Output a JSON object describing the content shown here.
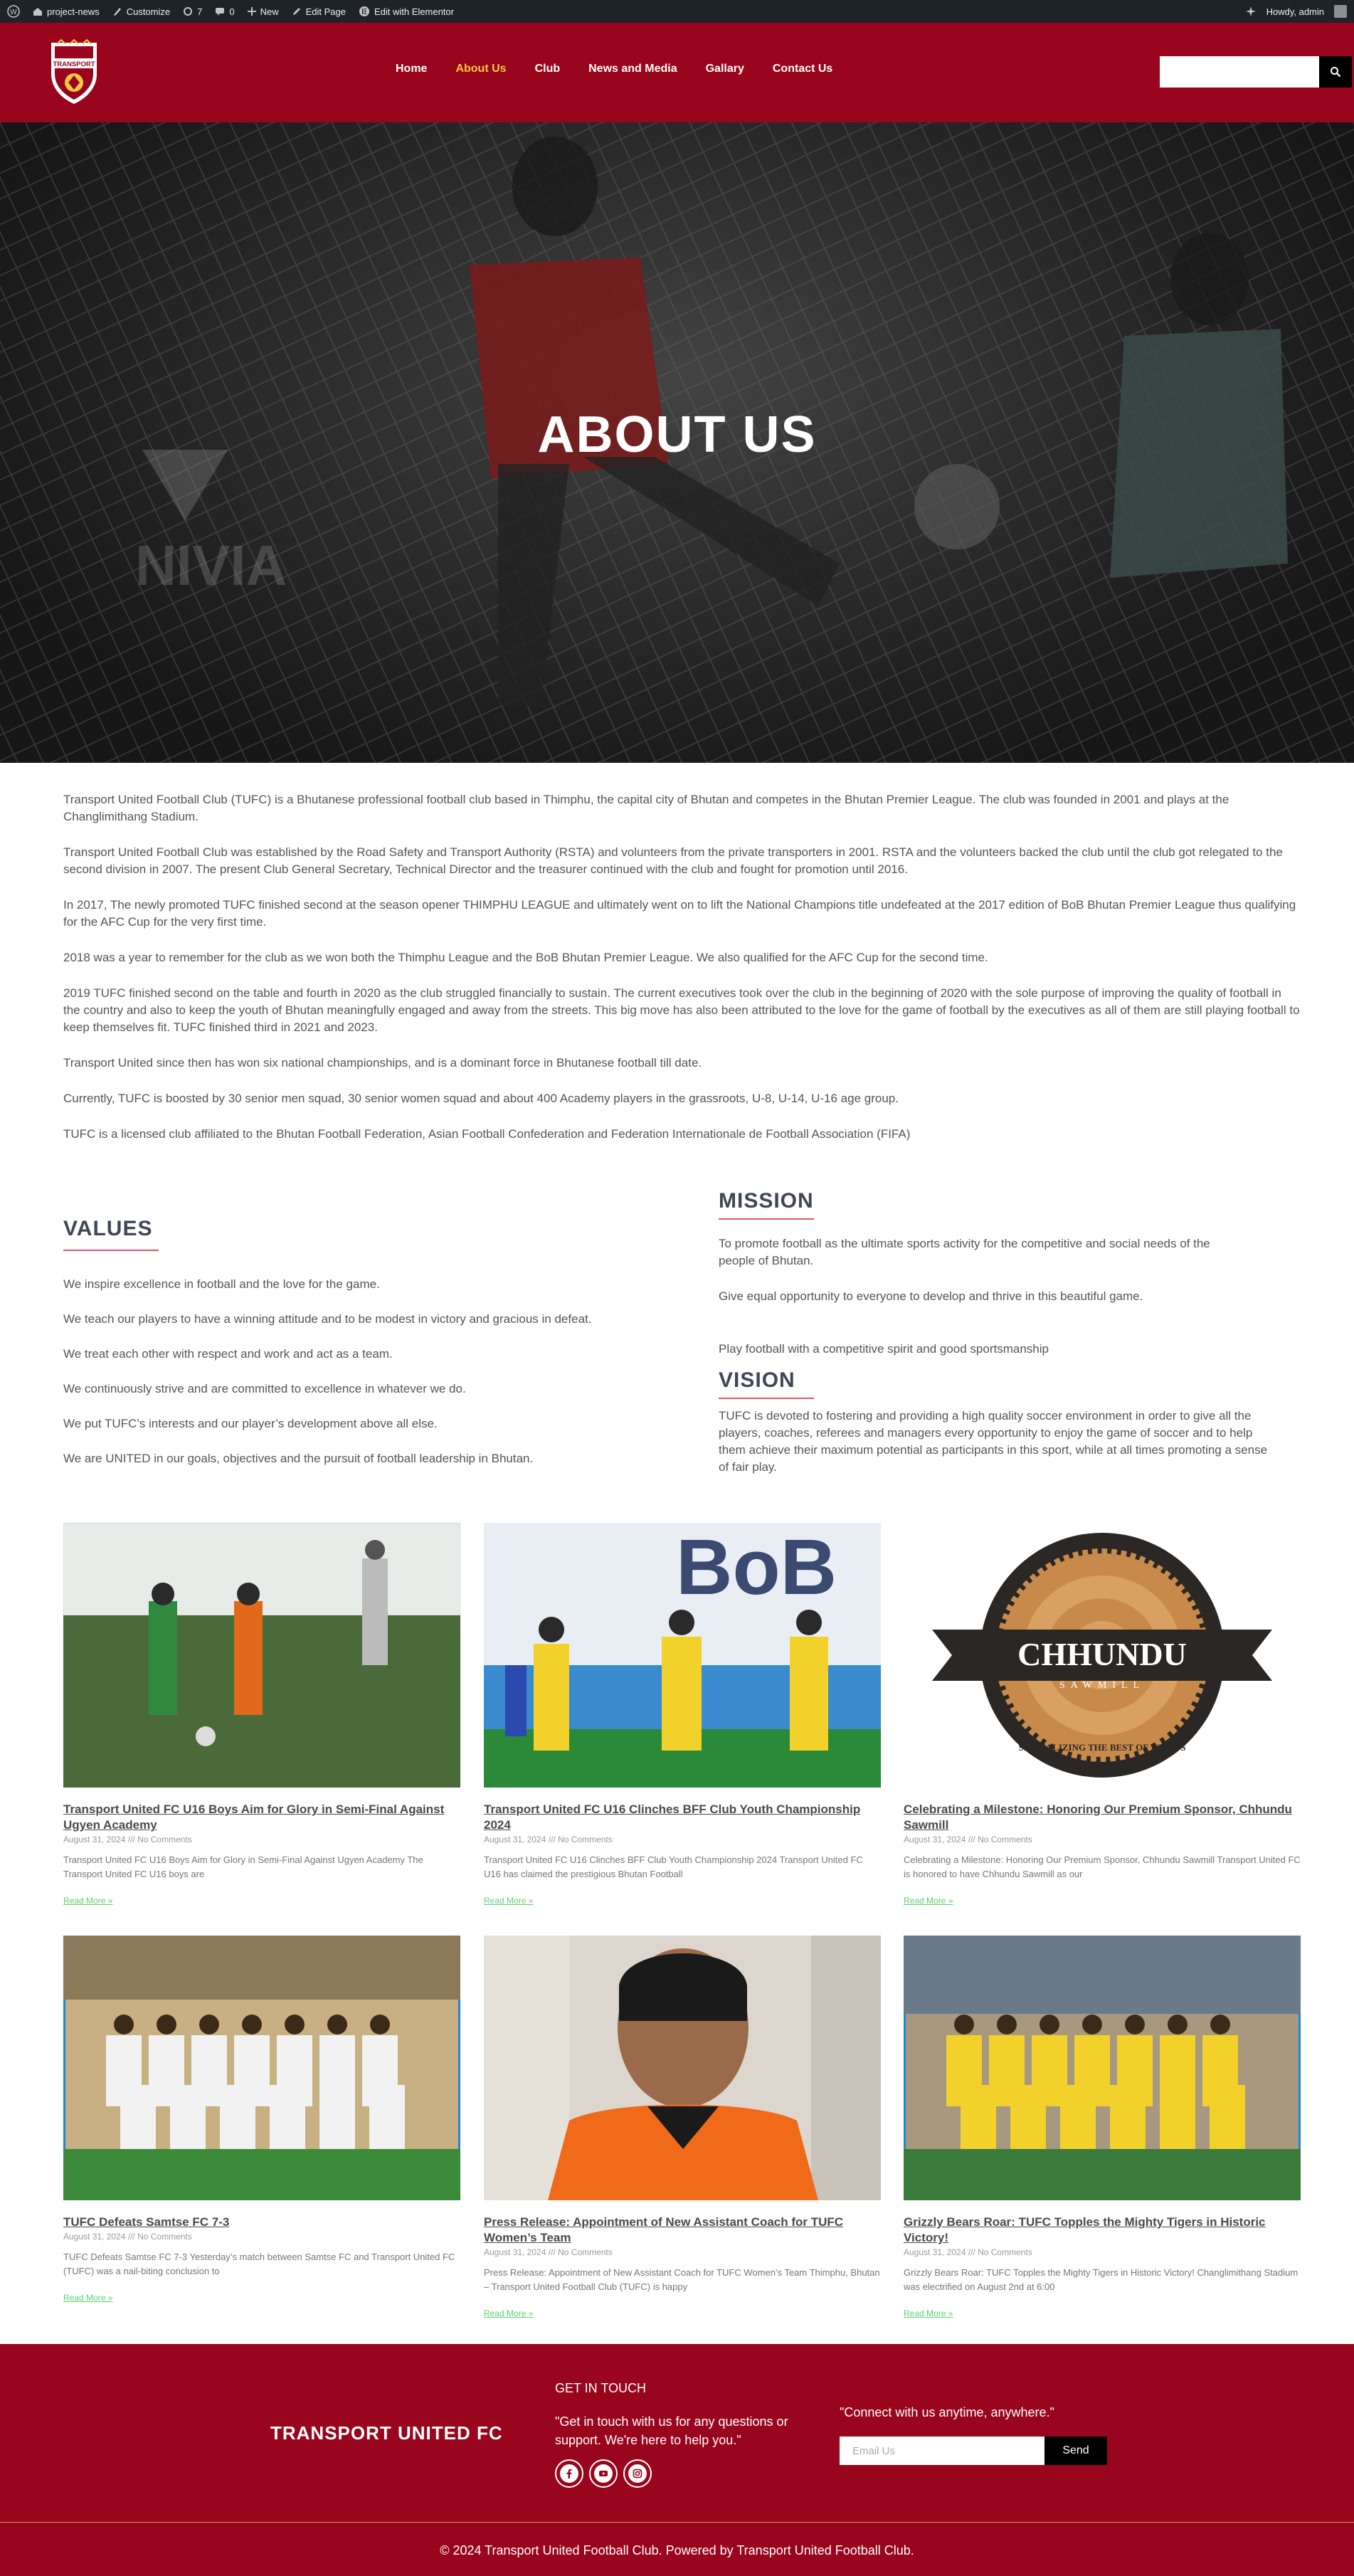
{
  "admin_bar": {
    "site_name": "project-news",
    "customize": "Customize",
    "updates_count": "7",
    "comments_count": "0",
    "new_label": "New",
    "edit_page": "Edit Page",
    "edit_elementor": "Edit with Elementor",
    "howdy": "Howdy, admin"
  },
  "header": {
    "logo_text": "TRANSPORT",
    "nav": [
      "Home",
      "About Us",
      "Club",
      "News and Media",
      "Gallary",
      "Contact Us"
    ],
    "active_nav": "About Us",
    "search_placeholder": ""
  },
  "hero": {
    "title": "ABOUT US"
  },
  "about": {
    "paragraphs": [
      "Transport United Football Club (TUFC) is a Bhutanese professional football club based in Thimphu, the capital city of Bhutan and competes in the Bhutan Premier League. The club was founded in 2001 and plays at the Changlimithang Stadium.",
      "Transport United Football Club was established by the Road Safety and Transport Authority (RSTA) and volunteers from the private transporters in 2001. RSTA and the volunteers backed the club until the club got relegated to the second division in 2007. The present Club General Secretary, Technical Director and the treasurer continued with the club and fought for promotion until 2016.",
      "In 2017, The newly promoted TUFC finished second at the season opener THIMPHU LEAGUE and ultimately went on to lift the National Champions title undefeated at the 2017 edition of BoB Bhutan Premier League thus qualifying for the AFC Cup for the very first time.",
      "2018 was a year to remember for the club as we won both the Thimphu League and the BoB Bhutan Premier League. We also qualified for the AFC Cup for the second time.",
      "2019 TUFC finished second on the table and fourth in 2020 as the club struggled financially to sustain. The current executives took over the club in the beginning of 2020 with the sole purpose of improving the quality of football in the country and also to keep the youth of Bhutan meaningfully engaged and away from the streets. This big move has also been attributed to the love for the game of football by the executives as all of them are still playing football to keep themselves fit. TUFC finished third in 2021 and 2023.",
      "Transport United since then has won six national championships, and is a dominant force in Bhutanese football till date.",
      "Currently, TUFC is boosted by 30 senior men squad, 30 senior women squad and about 400 Academy players in the grassroots, U-8, U-14, U-16 age group.",
      "TUFC is a licensed club affiliated to the Bhutan Football Federation, Asian Football Confederation and Federation Internationale de Football Association (FIFA)"
    ]
  },
  "values": {
    "title": "VALUES",
    "items": [
      "We inspire excellence in football and the love for the game.",
      "We teach our players to have a winning attitude and to be modest in victory and gracious in defeat.",
      "We treat each other with respect and work and act as a team.",
      "We continuously strive and are committed to excellence in whatever we do.",
      "We put TUFC’s interests and our player’s development above all else.",
      "We are UNITED in our goals, objectives and the pursuit of football leadership in Bhutan."
    ]
  },
  "mission": {
    "title": "MISSION",
    "items": [
      "To promote football as the ultimate sports activity for the competitive and social needs of the people of Bhutan.",
      "Give equal opportunity to everyone to develop and thrive in this beautiful game.",
      "Play football with a competitive spirit and good sportsmanship"
    ]
  },
  "vision": {
    "title": "VISION",
    "text": "TUFC is devoted to fostering and providing a high quality soccer environment in order to give all the players, coaches, referees and managers every opportunity to enjoy the game of soccer and to help them achieve their maximum potential as participants in this sport, while at all times promoting a sense of fair play."
  },
  "posts": [
    {
      "title": "Transport United FC U16 Boys Aim for Glory in Semi-Final Against Ugyen Academy",
      "meta": "August 31, 2024 /// No Comments",
      "excerpt": "Transport United FC U16 Boys Aim for Glory in Semi-Final Against Ugyen Academy The Transport United FC U16 boys are",
      "more": "Read More »",
      "image": "youth-football-match-photo"
    },
    {
      "title": "Transport United FC U16 Clinches BFF Club Youth Championship 2024",
      "meta": "August 31, 2024 /// No Comments",
      "excerpt": "Transport United FC U16 Clinches BFF Club Youth Championship 2024 Transport United FC U16 has claimed the prestigious Bhutan Football",
      "more": "Read More »",
      "image": "youth-championship-photo"
    },
    {
      "title": "Celebrating a Milestone: Honoring Our Premium Sponsor, Chhundu Sawmill",
      "meta": "August 31, 2024 /// No Comments",
      "excerpt": "Celebrating a Milestone: Honoring Our Premium Sponsor, Chhundu Sawmill Transport United FC is honored to have Chhundu Sawmill as our",
      "more": "Read More »",
      "image": "chhundu-sawmill-logo",
      "logo_text": "CHHUNDU",
      "logo_sub": "SAWMILL",
      "logo_ring": "SPECIALIZING THE BEST OF WOODS"
    },
    {
      "title": "TUFC Defeats Samtse FC 7-3",
      "meta": "August 31, 2024 /// No Comments",
      "excerpt": "TUFC Defeats Samtse FC 7-3 Yesterday’s match between Samtse FC and Transport United FC (TUFC) was a nail-biting conclusion to",
      "more": "Read More »",
      "image": "team-photo-white-kit"
    },
    {
      "title": "Press Release: Appointment of New Assistant Coach for TUFC Women’s Team",
      "meta": "August 31, 2024 /// No Comments",
      "excerpt": "Press Release: Appointment of New Assistant Coach for TUFC Women’s Team Thimphu, Bhutan – Transport United Football Club (TUFC) is happy",
      "more": "Read More »",
      "image": "assistant-coach-portrait"
    },
    {
      "title": "Grizzly Bears Roar: TUFC Topples the Mighty Tigers in Historic Victory!",
      "meta": "August 31, 2024 /// No Comments",
      "excerpt": "Grizzly Bears Roar: TUFC Topples the Mighty Tigers in Historic Victory! Changlimithang Stadium was electrified on August 2nd at 6:00",
      "more": "Read More »",
      "image": "team-photo-yellow-kit"
    }
  ],
  "footer": {
    "brand": "TRANSPORT UNITED FC",
    "get_in_touch_title": "GET IN TOUCH",
    "get_in_touch_text": "\"Get in touch with us for any questions or support. We're here to help you.\"",
    "socials": [
      "facebook-icon",
      "youtube-icon",
      "instagram-icon"
    ],
    "connect_text": "\"Connect with us anytime, anywhere.\"",
    "email_placeholder": "Email Us",
    "send_label": "Send",
    "copyright": "© 2024 Transport United Football Club. Powered by Transport United Football Club."
  },
  "colors": {
    "brand_red": "#98051c",
    "nav_active": "#f5c842",
    "heading": "#3f4656",
    "accent_underline": "#e25462",
    "read_more": "#61ce70"
  }
}
